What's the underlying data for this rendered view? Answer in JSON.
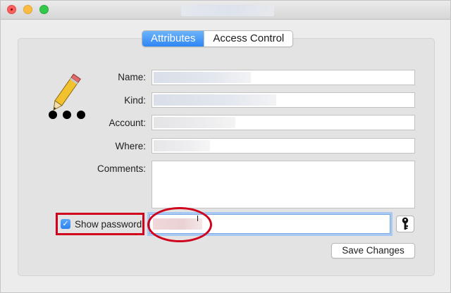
{
  "window": {
    "title_blurred": true
  },
  "tabs": [
    {
      "label": "Attributes",
      "active": true
    },
    {
      "label": "Access Control",
      "active": false
    }
  ],
  "form": {
    "name_label": "Name:",
    "kind_label": "Kind:",
    "account_label": "Account:",
    "where_label": "Where:",
    "comments_label": "Comments:",
    "name_value": "",
    "kind_value": "",
    "account_value": "",
    "where_value": "",
    "comments_value": ""
  },
  "password": {
    "show_label": "Show password",
    "show_checked": true,
    "value": ""
  },
  "buttons": {
    "save_label": "Save Changes"
  },
  "icons": {
    "item": "pencil-password-icon",
    "key": "key-icon"
  },
  "colors": {
    "accent": "#2f86f4",
    "annotation_red": "#d0021b"
  }
}
